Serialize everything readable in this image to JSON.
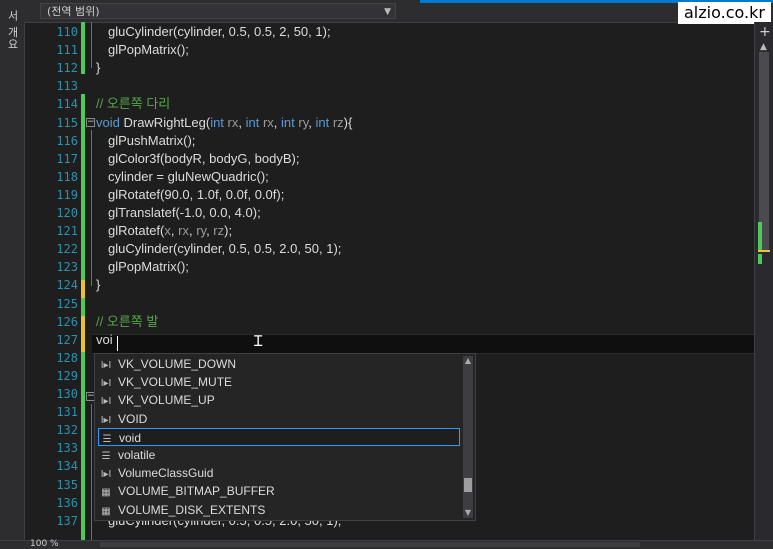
{
  "side_panel": {
    "label": "서 개요"
  },
  "scope_dropdown": {
    "value": "(전역 범위)"
  },
  "watermark": {
    "text": "alzio.co.kr"
  },
  "editor": {
    "lines": [
      {
        "num": "110",
        "text": "gluCylinder(cylinder, 0.5, 0.5, 2, 50, 1);",
        "kind": "code",
        "indent": 1
      },
      {
        "num": "111",
        "text": "glPopMatrix();",
        "kind": "code",
        "indent": 1
      },
      {
        "num": "112",
        "text": "}",
        "kind": "code",
        "indent": 0
      },
      {
        "num": "113",
        "text": "",
        "kind": "code",
        "indent": 0
      },
      {
        "num": "114",
        "text": "// 오른쪽 다리",
        "kind": "comment",
        "indent": 0
      },
      {
        "num": "115",
        "text": "",
        "kind": "signature",
        "indent": 0
      },
      {
        "num": "116",
        "text": "glPushMatrix();",
        "kind": "code",
        "indent": 1
      },
      {
        "num": "117",
        "text": "glColor3f(bodyR, bodyG, bodyB);",
        "kind": "code",
        "indent": 1
      },
      {
        "num": "118",
        "text": "cylinder = gluNewQuadric();",
        "kind": "code",
        "indent": 1
      },
      {
        "num": "119",
        "text": "glRotatef(90.0, 1.0f, 0.0f, 0.0f);",
        "kind": "code",
        "indent": 1
      },
      {
        "num": "120",
        "text": "glTranslatef(-1.0, 0.0, 4.0);",
        "kind": "code",
        "indent": 1
      },
      {
        "num": "121",
        "text": "",
        "kind": "rotate",
        "indent": 1
      },
      {
        "num": "122",
        "text": "gluCylinder(cylinder, 0.5, 0.5, 2.0, 50, 1);",
        "kind": "code",
        "indent": 1
      },
      {
        "num": "123",
        "text": "glPopMatrix();",
        "kind": "code",
        "indent": 1
      },
      {
        "num": "124",
        "text": "}",
        "kind": "code",
        "indent": 0
      },
      {
        "num": "125",
        "text": "",
        "kind": "code",
        "indent": 0
      },
      {
        "num": "126",
        "text": "// 오른쪽 발",
        "kind": "comment",
        "indent": 0
      },
      {
        "num": "127",
        "text": "voi",
        "kind": "code",
        "indent": 0
      },
      {
        "num": "128",
        "text": "",
        "kind": "code",
        "indent": 0
      },
      {
        "num": "129",
        "text": "",
        "kind": "code",
        "indent": 0
      },
      {
        "num": "130",
        "text": "",
        "kind": "code",
        "indent": 0
      },
      {
        "num": "131",
        "text": "",
        "kind": "code",
        "indent": 0
      },
      {
        "num": "132",
        "text": "",
        "kind": "code",
        "indent": 0
      },
      {
        "num": "133",
        "text": "",
        "kind": "code",
        "indent": 0
      },
      {
        "num": "134",
        "text": "",
        "kind": "code",
        "indent": 0
      },
      {
        "num": "135",
        "text": "",
        "kind": "code",
        "indent": 0
      },
      {
        "num": "136",
        "text": "",
        "kind": "code",
        "indent": 0
      },
      {
        "num": "137",
        "text": "gluCylinder(cylinder, 0.5, 0.5, 2.0, 50, 1);",
        "kind": "code",
        "indent": 1
      }
    ],
    "signature_115": {
      "ret": "void",
      "name": " DrawRightLeg(",
      "p1_type": "int",
      "p1_name": " rx",
      "p2_type": "int",
      "p2_name": " rx",
      "p3_type": "int",
      "p3_name": " ry",
      "p4_type": "int",
      "p4_name": " rz",
      "end": "){"
    },
    "rotate_121": {
      "fn": "glRotatef(",
      "a": "x",
      "b": "rx",
      "c": "ry",
      "d": "rz",
      "end": ");"
    }
  },
  "completion": {
    "items": [
      {
        "label": "VK_VOLUME_DOWN",
        "icon": "macro-icon",
        "glyph": "I▸I",
        "selected": false
      },
      {
        "label": "VK_VOLUME_MUTE",
        "icon": "macro-icon",
        "glyph": "I▸I",
        "selected": false
      },
      {
        "label": "VK_VOLUME_UP",
        "icon": "macro-icon",
        "glyph": "I▸I",
        "selected": false
      },
      {
        "label": "VOID",
        "icon": "macro-icon",
        "glyph": "I▸I",
        "selected": false
      },
      {
        "label": "void",
        "icon": "keyword-icon",
        "glyph": "☰",
        "selected": true
      },
      {
        "label": "volatile",
        "icon": "keyword-icon",
        "glyph": "☰",
        "selected": false
      },
      {
        "label": "VolumeClassGuid",
        "icon": "macro-icon",
        "glyph": "I▸I",
        "selected": false
      },
      {
        "label": "VOLUME_BITMAP_BUFFER",
        "icon": "struct-icon",
        "glyph": "▦",
        "selected": false
      },
      {
        "label": "VOLUME_DISK_EXTENTS",
        "icon": "struct-icon",
        "glyph": "▦",
        "selected": false
      }
    ]
  },
  "statusbar": {
    "zoom": "100 %"
  }
}
